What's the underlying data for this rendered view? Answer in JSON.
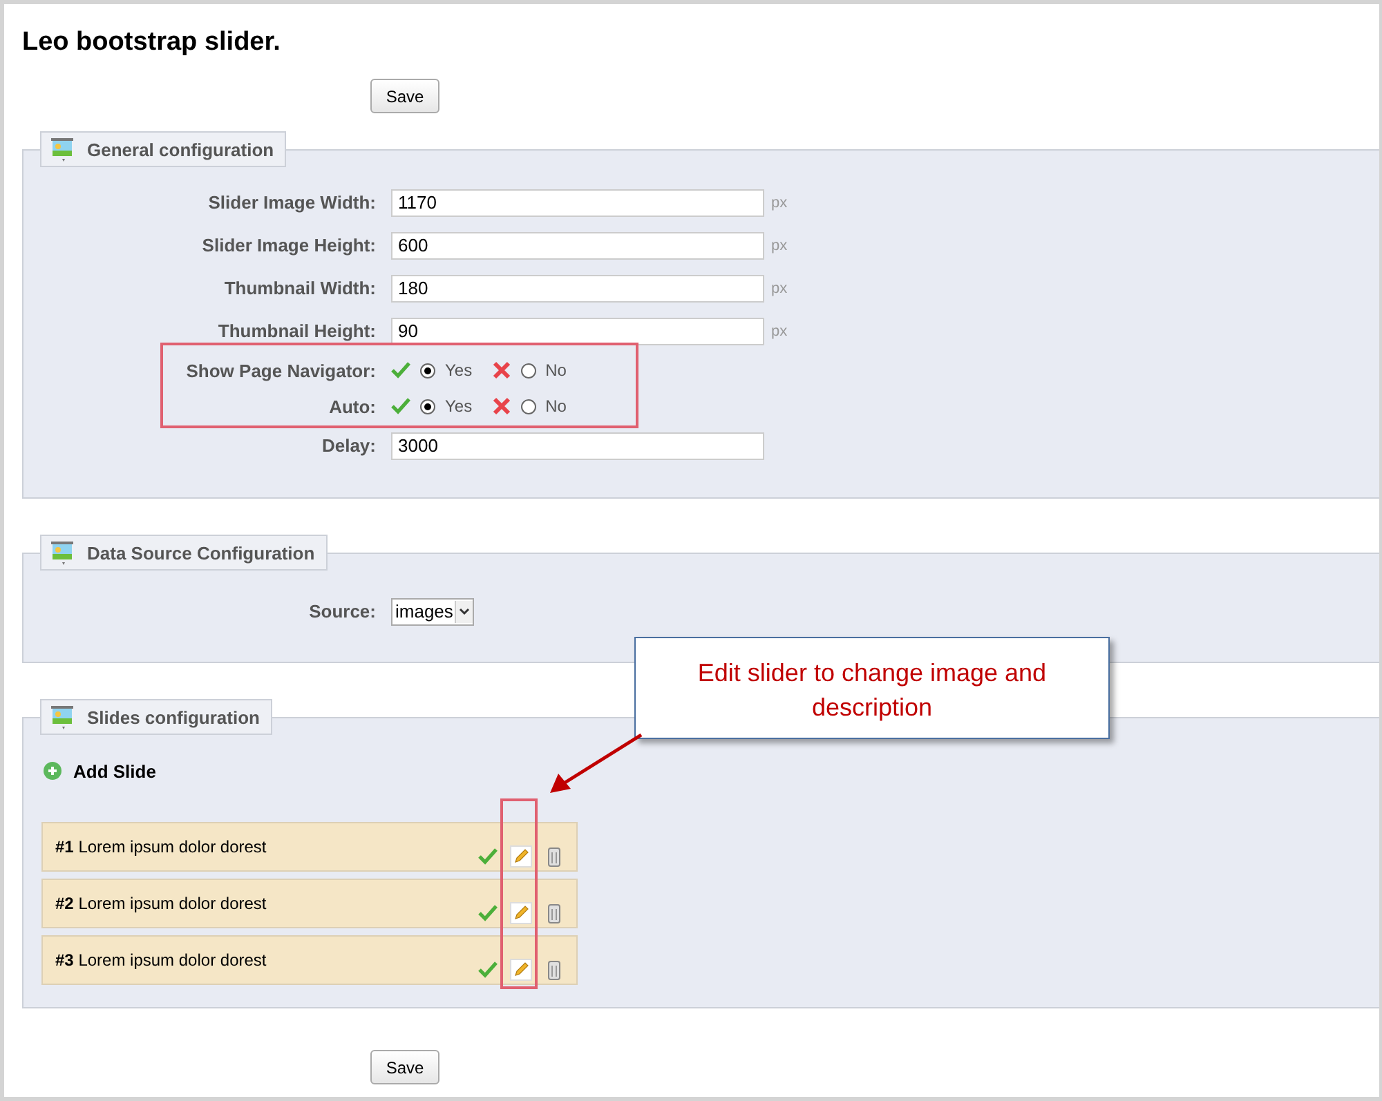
{
  "title": "Leo bootstrap slider.",
  "top_button": "Save",
  "general": {
    "legend": "General configuration",
    "fields": [
      {
        "kind": "text",
        "label": "Slider Image Width:",
        "value": "1170",
        "unit": "px"
      },
      {
        "kind": "text",
        "label": "Slider Image Height:",
        "value": "600",
        "unit": "px"
      },
      {
        "kind": "text",
        "label": "Thumbnail Width:",
        "value": "180",
        "unit": "px"
      },
      {
        "kind": "text",
        "label": "Thumbnail Height:",
        "value": "90",
        "unit": "px"
      },
      {
        "kind": "radio",
        "label": "Show Page Navigator:",
        "options": [
          {
            "label": "Yes",
            "kind": "yes",
            "selected": true
          },
          {
            "label": "No",
            "kind": "no",
            "selected": false
          }
        ]
      },
      {
        "kind": "radio",
        "label": "Auto:",
        "options": [
          {
            "label": "Yes",
            "kind": "yes",
            "selected": true
          },
          {
            "label": "No",
            "kind": "no",
            "selected": false
          }
        ]
      },
      {
        "kind": "text",
        "label": "Delay:",
        "value": "3000"
      }
    ]
  },
  "data_source": {
    "legend": "Data Source Configuration",
    "label": "Source:",
    "value": "images"
  },
  "slides": {
    "legend": "Slides configuration",
    "add_label": "Add Slide",
    "items": [
      {
        "number": "#1",
        "title": "Lorem ipsum dolor dorest"
      },
      {
        "number": "#2",
        "title": "Lorem ipsum dolor dorest"
      },
      {
        "number": "#3",
        "title": "Lorem ipsum dolor dorest"
      }
    ]
  },
  "callout": "Edit slider to change image and description",
  "bottom_button": "Save"
}
